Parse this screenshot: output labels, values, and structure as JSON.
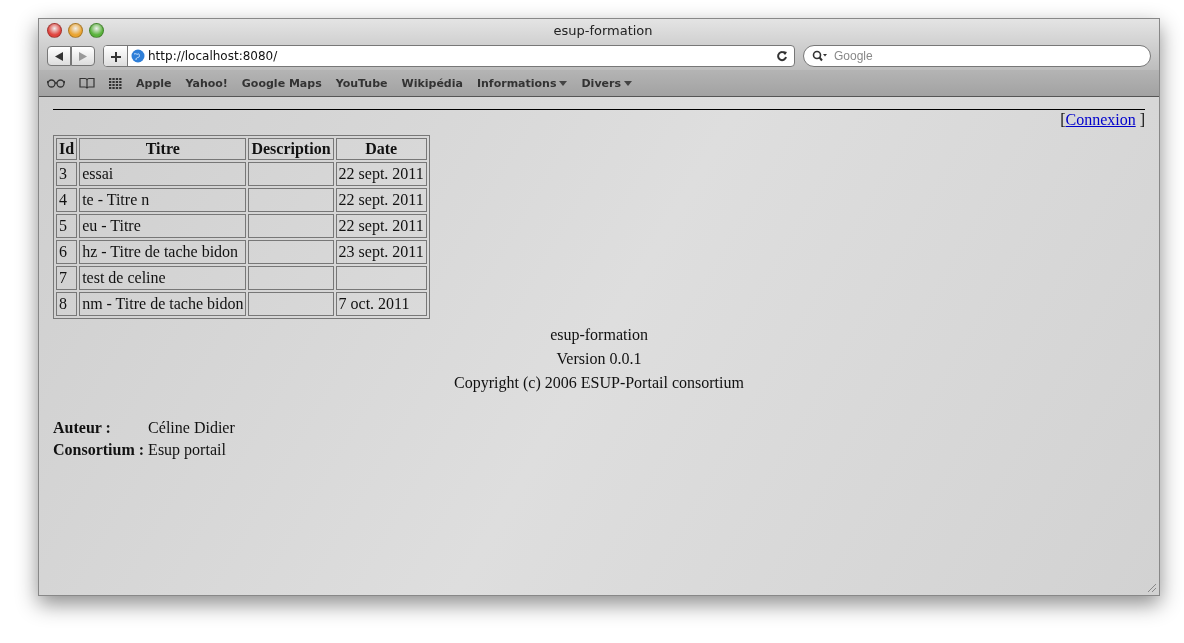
{
  "window": {
    "title": "esup-formation"
  },
  "toolbar": {
    "url": "http://localhost:8080/",
    "search": {
      "placeholder": "Google"
    }
  },
  "bookmarks": [
    {
      "label": "Apple",
      "menu": false
    },
    {
      "label": "Yahoo!",
      "menu": false
    },
    {
      "label": "Google Maps",
      "menu": false
    },
    {
      "label": "YouTube",
      "menu": false
    },
    {
      "label": "Wikipédia",
      "menu": false
    },
    {
      "label": "Informations",
      "menu": true
    },
    {
      "label": "Divers",
      "menu": true
    }
  ],
  "login": {
    "open": "[",
    "link": "Connexion",
    "close": "]"
  },
  "table": {
    "columns": [
      "Id",
      "Titre",
      "Description",
      "Date"
    ],
    "rows": [
      [
        "3",
        "essai",
        "",
        "22 sept. 2011"
      ],
      [
        "4",
        "te - Titre n",
        "",
        "22 sept. 2011"
      ],
      [
        "5",
        "eu - Titre",
        "",
        "22 sept. 2011"
      ],
      [
        "6",
        "hz - Titre de tache bidon",
        "",
        "23 sept. 2011"
      ],
      [
        "7",
        "test de celine",
        "",
        ""
      ],
      [
        "8",
        "nm - Titre de tache bidon",
        "",
        "7 oct. 2011"
      ]
    ]
  },
  "footer": [
    "esup-formation",
    "Version 0.0.1",
    "Copyright (c) 2006 ESUP-Portail consortium"
  ],
  "info": [
    {
      "label": "Auteur :",
      "value": "Céline Didier"
    },
    {
      "label": "Consortium :",
      "value": "Esup portail"
    }
  ]
}
